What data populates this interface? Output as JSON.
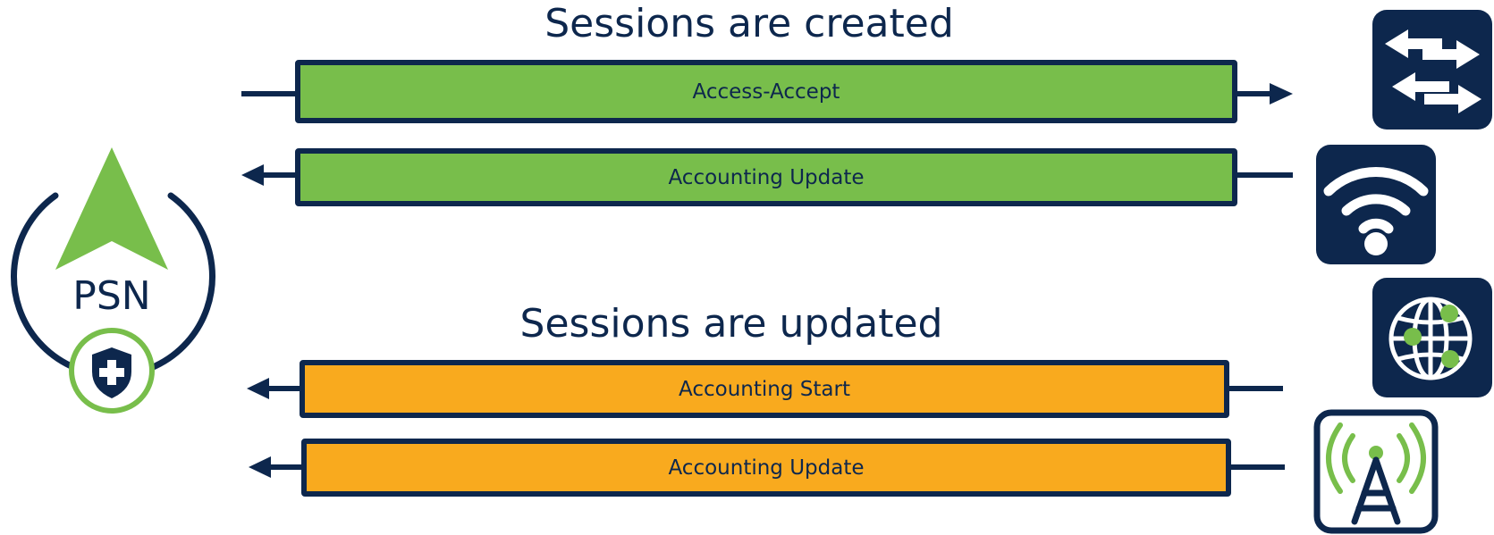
{
  "colors": {
    "navy": "#0d274d",
    "green": "#78be4b",
    "orange": "#f9aa1e",
    "white": "#ffffff"
  },
  "headings": {
    "created": "Sessions are created",
    "updated": "Sessions are updated"
  },
  "psn": {
    "label": "PSN",
    "icons": [
      "navigation-arrow-icon",
      "shield-plus-icon"
    ]
  },
  "messages": [
    {
      "label": "Access-Accept",
      "direction": "to-devices",
      "color": "green"
    },
    {
      "label": "Accounting Update",
      "direction": "to-psn",
      "color": "green"
    },
    {
      "label": "Accounting Start",
      "direction": "to-psn",
      "color": "orange"
    },
    {
      "label": "Accounting Update",
      "direction": "to-psn",
      "color": "orange"
    }
  ],
  "devices": [
    {
      "name": "switch",
      "icon": "switch-arrows-icon"
    },
    {
      "name": "wireless",
      "icon": "wifi-icon"
    },
    {
      "name": "network",
      "icon": "globe-icon"
    },
    {
      "name": "cell-tower",
      "icon": "cell-tower-icon"
    }
  ]
}
